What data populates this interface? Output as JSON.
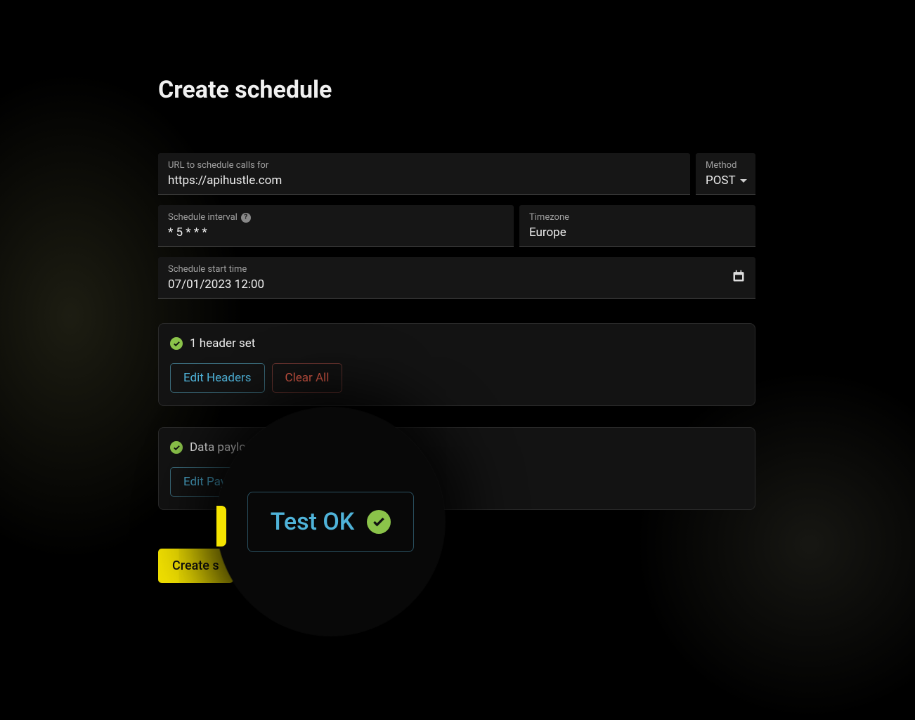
{
  "page": {
    "title": "Create schedule"
  },
  "fields": {
    "url": {
      "label": "URL to schedule calls for",
      "value": "https://apihustle.com"
    },
    "method": {
      "label": "Method",
      "value": "POST"
    },
    "interval": {
      "label": "Schedule interval",
      "value": "* 5 * * *"
    },
    "timezone": {
      "label": "Timezone",
      "value": "Europe"
    },
    "starttime": {
      "label": "Schedule start time",
      "value": "07/01/2023 12:00"
    }
  },
  "headers_section": {
    "status": "1 header set",
    "edit_label": "Edit Headers",
    "clear_label": "Clear All"
  },
  "payload_section": {
    "status": "Data payload set",
    "edit_label": "Edit Payload"
  },
  "actions": {
    "create_label": "Create schedule",
    "create_label_truncated": "Create s"
  },
  "test": {
    "label": "Test OK"
  },
  "colors": {
    "accent_yellow": "#f5e400",
    "accent_blue": "#4fb3d9",
    "accent_green": "#8bc34a",
    "accent_red": "#e8604c"
  }
}
